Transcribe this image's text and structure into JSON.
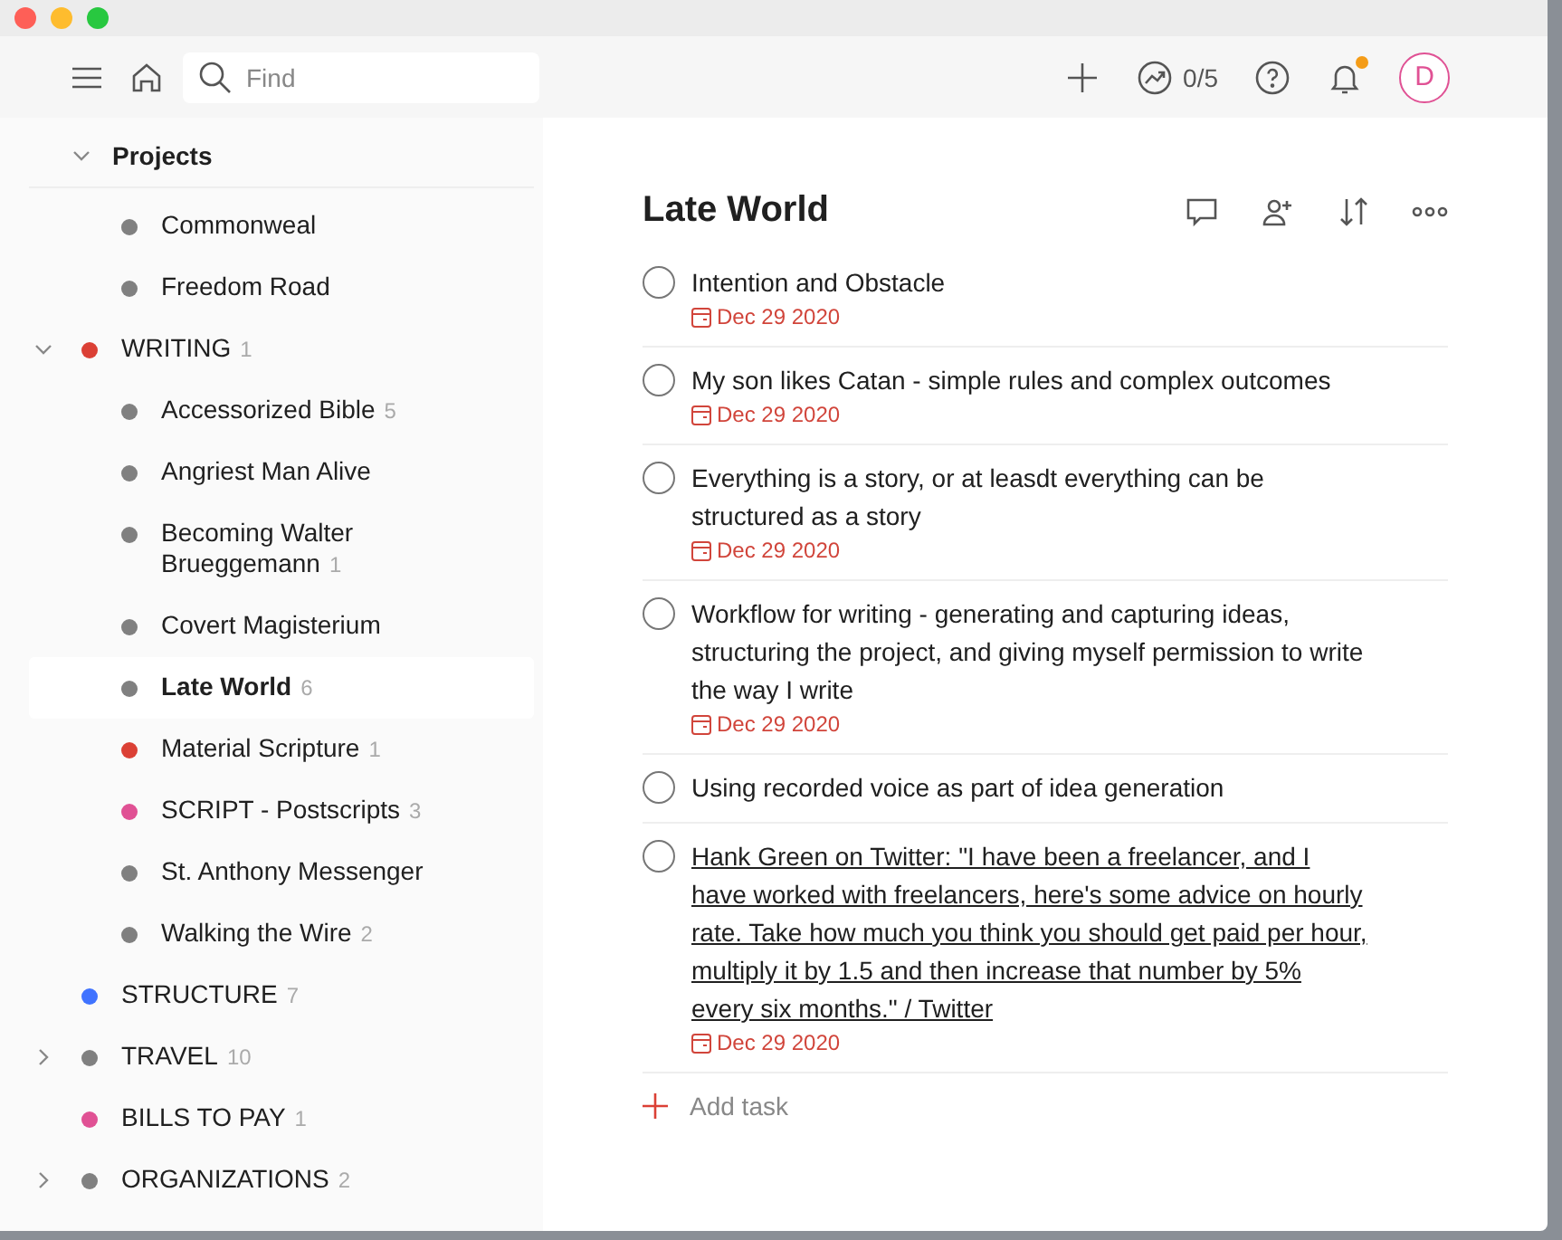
{
  "toolbar": {
    "search": {
      "placeholder": "Find"
    },
    "karma": "0/5",
    "notifications_unread": true,
    "avatar": "D"
  },
  "sidebar": {
    "section": {
      "title": "Projects",
      "expanded": true
    },
    "continued_children": [
      {
        "name": "Commonweal",
        "color": "#808080",
        "selected": false
      },
      {
        "name": "Freedom Road",
        "color": "#808080",
        "selected": false
      }
    ],
    "projects": [
      {
        "name": "WRITING",
        "count": "1",
        "color": "#db4035",
        "expanded": true,
        "selected": false,
        "children": [
          {
            "name": "Accessorized Bible",
            "count": "5",
            "color": "#808080",
            "selected": false
          },
          {
            "name": "Angriest Man Alive",
            "color": "#808080",
            "selected": false
          },
          {
            "name": "Becoming Walter Brueggemann",
            "count": "1",
            "color": "#808080",
            "selected": false
          },
          {
            "name": "Covert Magisterium",
            "color": "#808080",
            "selected": false
          },
          {
            "name": "Late World",
            "count": "6",
            "color": "#808080",
            "selected": true
          },
          {
            "name": "Material Scripture",
            "count": "1",
            "color": "#db4035",
            "selected": false
          },
          {
            "name": "SCRIPT - Postscripts",
            "count": "3",
            "color": "#e05194",
            "selected": false
          },
          {
            "name": "St. Anthony Messenger",
            "color": "#808080",
            "selected": false
          },
          {
            "name": "Walking the Wire",
            "count": "2",
            "color": "#808080",
            "selected": false
          }
        ]
      },
      {
        "name": "STRUCTURE",
        "count": "7",
        "color": "#4073ff",
        "selected": false
      },
      {
        "name": "TRAVEL",
        "count": "10",
        "color": "#808080",
        "expanded": false,
        "selected": false
      },
      {
        "name": "BILLS TO PAY",
        "count": "1",
        "color": "#e05194",
        "selected": false
      },
      {
        "name": "ORGANIZATIONS",
        "count": "2",
        "color": "#808080",
        "expanded": false,
        "selected": false
      }
    ]
  },
  "main": {
    "title": "Late World",
    "tasks": [
      {
        "text": "Intention and Obstacle",
        "kind": "plain",
        "checked": false,
        "date": "Dec 29 2020"
      },
      {
        "text": "My son likes Catan - simple rules and complex outcomes",
        "kind": "plain",
        "checked": false,
        "date": "Dec 29 2020"
      },
      {
        "text": "Everything is a story, or at leasdt everything can be structured as a story",
        "kind": "plain",
        "checked": false,
        "date": "Dec 29 2020"
      },
      {
        "text": "Workflow for writing - generating and capturing ideas, structuring the project, and giving myself permission to write the way I write",
        "kind": "plain",
        "checked": false,
        "date": "Dec 29 2020"
      },
      {
        "text": "Using recorded voice as part of idea generation",
        "kind": "plain",
        "checked": false
      },
      {
        "text": "Hank Green on Twitter: \"I have been a freelancer, and I have worked with freelancers, here's some advice on hourly rate. Take how much you think you should get paid per hour, multiply it by 1.5 and then increase that number by 5% every six months.\" / Twitter",
        "kind": "link",
        "checked": false,
        "date": "Dec 29 2020"
      }
    ],
    "add_task": "Add task"
  }
}
